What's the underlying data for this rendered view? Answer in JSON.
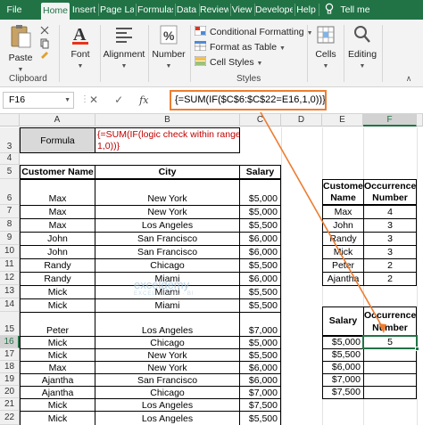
{
  "tabs": [
    "File",
    "Home",
    "Insert",
    "Page Layo",
    "Formulas",
    "Data",
    "Review",
    "View",
    "Develope",
    "Help"
  ],
  "tell_me": "Tell me",
  "ribbon": {
    "paste": "Paste",
    "clipboard": "Clipboard",
    "font": "Font",
    "alignment": "Alignment",
    "number": "Number",
    "conditional_formatting": "Conditional Formatting",
    "format_as_table": "Format as Table",
    "cell_styles": "Cell Styles",
    "styles": "Styles",
    "cells": "Cells",
    "editing": "Editing"
  },
  "formula_bar": {
    "name_box": "F16",
    "formula": "{=SUM(IF($C$6:$C$22=E16,1,0))}"
  },
  "columns": [
    "A",
    "B",
    "C",
    "D",
    "E",
    "F"
  ],
  "rows": {
    "r3": "3",
    "r4": "4",
    "r5": "5",
    "r6": "6",
    "r7": "7",
    "r8": "8",
    "r9": "9",
    "r10": "10",
    "r11": "11",
    "r12": "12",
    "r13": "13",
    "r14": "14",
    "r15": "15",
    "r16": "16",
    "r17": "17",
    "r18": "18",
    "r19": "19",
    "r20": "20",
    "r21": "21",
    "r22": "22"
  },
  "formula_label": "Formula",
  "formula_text_line1": "{=SUM(IF(logic check within range,",
  "formula_text_line2": "1,0))}",
  "main_table": {
    "headers": [
      "Customer Name",
      "City",
      "Salary"
    ],
    "rows": [
      [
        "Max",
        "New York",
        "$5,000"
      ],
      [
        "Max",
        "New York",
        "$5,000"
      ],
      [
        "Max",
        "Los Angeles",
        "$5,500"
      ],
      [
        "John",
        "San Francisco",
        "$6,000"
      ],
      [
        "John",
        "San Francisco",
        "$6,000"
      ],
      [
        "Randy",
        "Chicago",
        "$5,500"
      ],
      [
        "Randy",
        "Miami",
        "$6,000"
      ],
      [
        "Mick",
        "Miami",
        "$5,500"
      ],
      [
        "Mick",
        "Miami",
        "$5,500"
      ],
      [
        "Peter",
        "Los Angeles",
        "$7,000"
      ],
      [
        "Mick",
        "Chicago",
        "$5,000"
      ],
      [
        "Mick",
        "New York",
        "$5,500"
      ],
      [
        "Max",
        "New York",
        "$6,000"
      ],
      [
        "Ajantha",
        "San Francisco",
        "$6,000"
      ],
      [
        "Ajantha",
        "Chicago",
        "$7,000"
      ],
      [
        "Mick",
        "Los Angeles",
        "$7,500"
      ],
      [
        "Mick",
        "Los Angeles",
        "$5,500"
      ]
    ]
  },
  "occ_table": {
    "h1_line1": "Customer",
    "h1_line2": "Name",
    "h2_line1": "Occurrence",
    "h2_line2": "Number",
    "rows": [
      [
        "Max",
        "4"
      ],
      [
        "John",
        "3"
      ],
      [
        "Randy",
        "3"
      ],
      [
        "Mick",
        "3"
      ],
      [
        "Peter",
        "2"
      ],
      [
        "Ajantha",
        "2"
      ]
    ]
  },
  "salary_table": {
    "h1": "Salary",
    "h2_line1": "Occurrence",
    "h2_line2": "Number",
    "rows": [
      [
        "$5,000",
        "5"
      ],
      [
        "$5,500",
        ""
      ],
      [
        "$6,000",
        ""
      ],
      [
        "$7,000",
        ""
      ],
      [
        "$7,500",
        ""
      ]
    ]
  },
  "watermark": "exceldemy",
  "watermark_sub": "EXCEL · DATA · BI",
  "colors": {
    "excel_green": "#217346",
    "callout_orange": "#ed7d31",
    "header_gray": "#d9d9d9"
  }
}
